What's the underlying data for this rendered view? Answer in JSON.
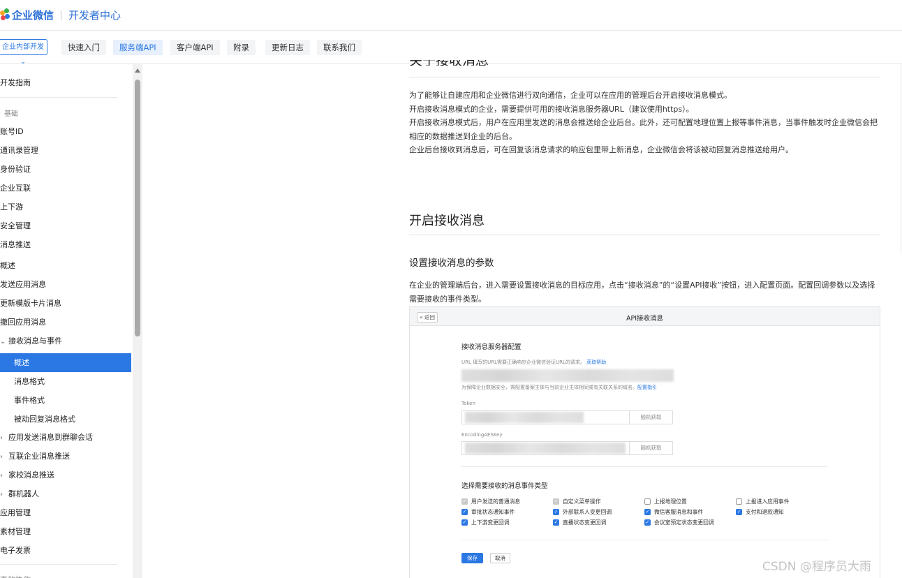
{
  "header": {
    "brand": "企业微信",
    "subtitle": "开发者中心",
    "logo_colors": [
      "#f6a623",
      "#36b14a",
      "#2b78e4",
      "#e8474c"
    ]
  },
  "navbar": {
    "dropdown": "企业内部开发",
    "tabs": [
      "快速入门",
      "服务端API",
      "客户端API",
      "附录",
      "更新日志",
      "联系我们"
    ],
    "active_tab": "服务端API"
  },
  "sidebar": {
    "top": "开发指南",
    "group": "基础",
    "items": [
      "账号ID",
      "通讯录管理",
      "身份验证",
      "企业互联",
      "上下游",
      "安全管理",
      "消息推送",
      "概述",
      "发送应用消息",
      "更新模版卡片消息",
      "撤回应用消息"
    ],
    "expanded": "接收消息与事件",
    "subitems": [
      "概述",
      "消息格式",
      "事件格式",
      "被动回复消息格式"
    ],
    "collapsed": [
      "应用发送消息到群聊会话",
      "互联企业消息推送",
      "家校消息推送",
      "群机器人"
    ],
    "bottom": [
      "应用管理",
      "素材管理",
      "电子发票"
    ],
    "cut_item": "高效协作"
  },
  "content": {
    "cut_heading": "关于接收消息",
    "intro": [
      "为了能够让自建应用和企业微信进行双向通信，企业可以在应用的管理后台开启接收消息模式。",
      "开启接收消息模式的企业，需要提供可用的接收消息服务器URL（建议使用https）。",
      "开启接收消息模式后，用户在应用里发送的消息会推送给企业后台。此外，还可配置地理位置上报等事件消息，当事件触发时企业微信会把相应的数据推送到企业的后台。",
      "企业后台接收到消息后，可在回复该消息请求的响应包里带上新消息，企业微信会将该被动回复消息推送给用户。"
    ],
    "h2": "开启接收消息",
    "h3": "设置接收消息的参数",
    "desc": "在企业的管理端后台，进入需要设置接收消息的目标应用，点击“接收消息”的“设置API接收”按钮，进入配置页面。配置回调参数以及选择需要接收的事件类型。"
  },
  "mock": {
    "back": "« 返回",
    "title": "API接收消息",
    "server_config": "接收消息服务器配置",
    "url_hint": "URL  填写的URL需要正确响应企业微信验证URL的请求。",
    "url_help": "获取帮助",
    "security_hint": "为保障企业数据安全，需配置备案主体与当前企业主体相同或有关联关系的域名。",
    "security_link": "配置指引",
    "token_label": "Token",
    "aes_label": "EncodingAESKey",
    "random_btn": "随机获取",
    "events_title": "选择需要接收的消息事件类型",
    "events": [
      {
        "label": "用户发送的普通消息",
        "state": "dis"
      },
      {
        "label": "自定义菜单操作",
        "state": "dis"
      },
      {
        "label": "上报地理位置",
        "state": "off"
      },
      {
        "label": "上报进入应用事件",
        "state": "off"
      },
      {
        "label": "审批状态通知事件",
        "state": "on"
      },
      {
        "label": "外部联系人变更回调",
        "state": "on"
      },
      {
        "label": "微信客服消息和事件",
        "state": "on"
      },
      {
        "label": "支付和退款通知",
        "state": "on"
      },
      {
        "label": "上下游变更回调",
        "state": "on"
      },
      {
        "label": "直播状态变更回调",
        "state": "on"
      },
      {
        "label": "会议室预定状态变更回调",
        "state": "on"
      }
    ],
    "save": "保存",
    "cancel": "取消"
  },
  "watermark": "CSDN @程序员大雨",
  "colors": {
    "accent": "#2b78e4"
  }
}
